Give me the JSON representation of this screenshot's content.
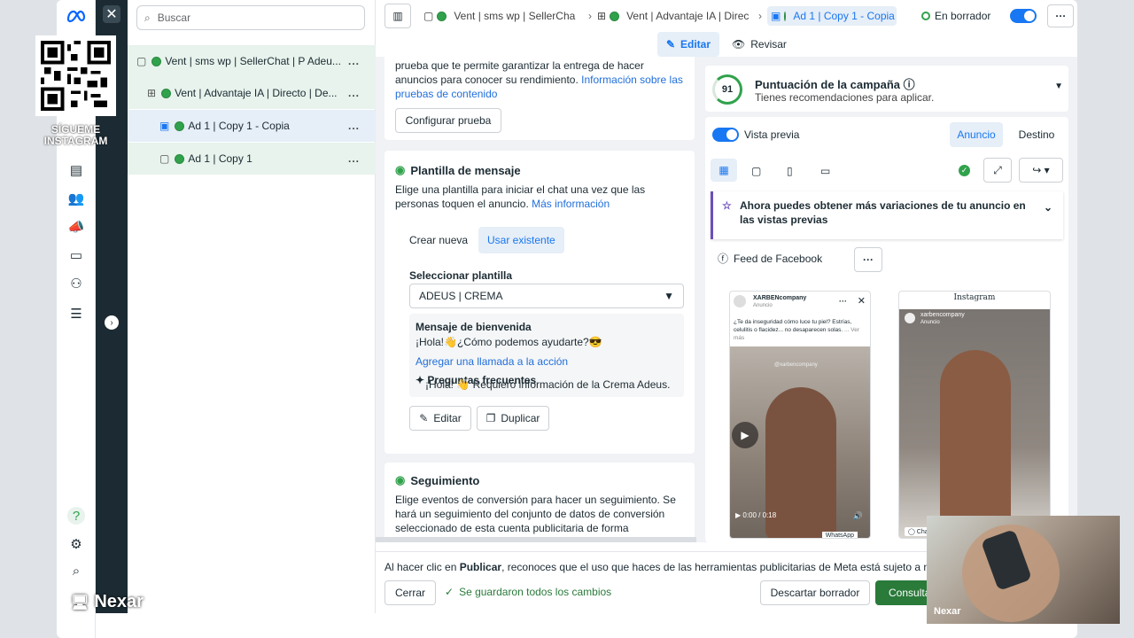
{
  "overlay": {
    "qr_caption": "SÍGUEME\nINSTAGRAM",
    "watermark": "Nexar",
    "webcam_name": "Nexar"
  },
  "search": {
    "placeholder": "Buscar"
  },
  "tree": {
    "items": [
      {
        "label": "Vent | sms wp | SellerChat | P Adeu...",
        "icon": "folder-icon"
      },
      {
        "label": "Vent | Advantaje IA | Directo | De...",
        "icon": "grid-icon"
      },
      {
        "label": "Ad 1 | Copy 1 - Copia",
        "icon": "ad-icon"
      },
      {
        "label": "Ad 1 | Copy 1",
        "icon": "ad-outline-icon"
      }
    ],
    "more": "..."
  },
  "topbar": {
    "crumbs": [
      "Vent | sms wp | SellerCha",
      "Vent | Advantaje IA | Direc",
      "Ad 1 | Copy 1 - Copia"
    ],
    "status": "En borrador",
    "tab_edit": "Editar",
    "tab_review": "Revisar"
  },
  "test": {
    "text_cut": "prueba que te permite garantizar la entrega de hacer anuncios para conocer su rendimiento.",
    "link": "Información sobre las pruebas de contenido",
    "configure_btn": "Configurar prueba"
  },
  "template": {
    "title": "Plantilla de mensaje",
    "desc": "Elige una plantilla para iniciar el chat una vez que las personas toquen el anuncio.",
    "more_link": "Más información",
    "tab_new": "Crear nueva",
    "tab_existing": "Usar existente",
    "select_label": "Seleccionar plantilla",
    "select_value": "ADEUS | CREMA",
    "welcome_title": "Mensaje de bienvenida",
    "welcome_text": "¡Hola!👋¿Cómo podemos ayudarte?😎",
    "cta_link": "Agregar una llamada a la acción",
    "faq_title": "Preguntas frecuentes",
    "faq_text": "¡Hola! 👋 Requiero información de la Crema Adeus.",
    "edit_btn": "Editar",
    "duplicate_btn": "Duplicar"
  },
  "tracking": {
    "title": "Seguimiento",
    "desc": "Elige eventos de conversión para hacer un seguimiento. Se hará un seguimiento del conjunto de datos de conversión seleccionado de esta cuenta publicitaria de forma predeterminada."
  },
  "score": {
    "value": "91",
    "title": "Puntuación de la campaña",
    "subtitle": "Tienes recomendaciones para aplicar."
  },
  "preview": {
    "toggle_label": "Vista previa",
    "tab_ad": "Anuncio",
    "tab_dest": "Destino",
    "banner": "Ahora puedes obtener más variaciones de tu anuncio en las vistas previas",
    "placement": "Feed de Facebook",
    "fb_account": "XARBENcompany",
    "fb_sub": "Anuncio",
    "fb_copy": "¿Te da inseguridad cómo luce tu piel? Estrías, celulitis o flacidez... no desaparecen solas.",
    "fb_more": "... Ver más",
    "fb_time": "0:00 / 0:18",
    "fb_wa": "WhatsApp",
    "watermark_handle": "@xarbencompany",
    "ig_header": "Instagram",
    "ig_account": "xarbencompany",
    "ig_sub": "Anuncio",
    "ig_cta": "Chat"
  },
  "footer": {
    "notice_pre": "Al hacer clic en ",
    "notice_bold": "Publicar",
    "notice_post": ", reconoces que el uso que haces de las herramientas publicitarias de Meta está sujeto a nuestras",
    "close_btn": "Cerrar",
    "saved": "Se guardaron todos los cambios",
    "discard_btn": "Descartar borrador",
    "consult_btn": "Consulta"
  },
  "colors": {
    "accent": "#1877f2",
    "green": "#31a24c",
    "dark": "#1c2b33"
  }
}
